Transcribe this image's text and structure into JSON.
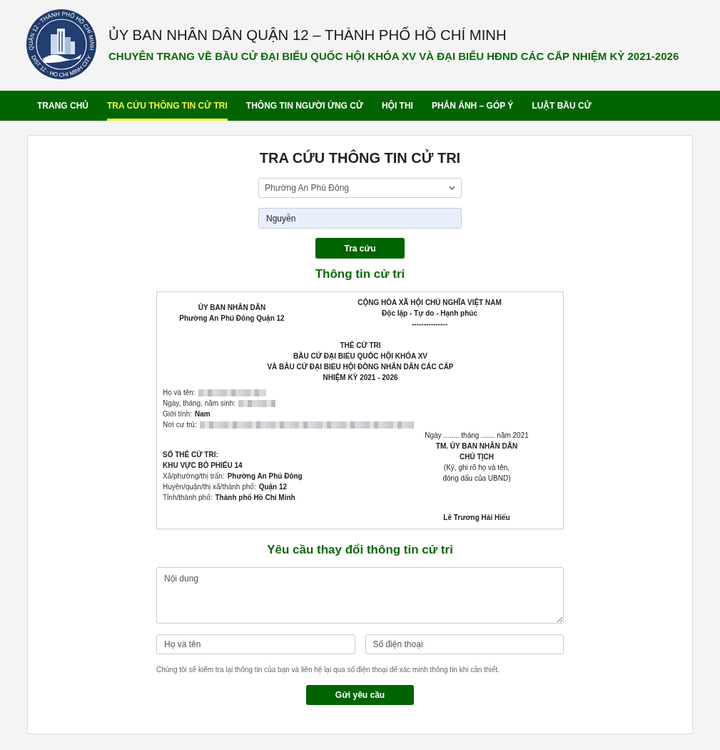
{
  "header": {
    "emblem": {
      "ring_top": "QUẬN 12 - THÀNH PHỐ HỒ CHÍ MINH",
      "ring_bottom": "DIST 12 - HO CHI MINH CITY"
    },
    "title": "ỦY BAN NHÂN DÂN QUẬN 12 – THÀNH PHỐ HỒ CHÍ MINH",
    "subtitle": "CHUYÊN TRANG VỀ BẦU CỬ ĐẠI BIỂU QUỐC HỘI KHÓA XV VÀ ĐẠI BIỂU HĐND CÁC CẤP NHIỆM KỲ 2021-2026"
  },
  "nav": [
    {
      "label": "TRANG CHỦ",
      "selected": false
    },
    {
      "label": "TRA CỨU THÔNG TIN CỬ TRI",
      "selected": true
    },
    {
      "label": "THÔNG TIN NGƯỜI ỨNG CỬ",
      "selected": false
    },
    {
      "label": "HỘI THI",
      "selected": false
    },
    {
      "label": "PHẢN ÁNH – GÓP Ý",
      "selected": false
    },
    {
      "label": "LUẬT BẦU CỬ",
      "selected": false
    }
  ],
  "lookup": {
    "title": "TRA CỨU THÔNG TIN CỬ TRI",
    "ward_select": {
      "value": "Phường An Phú Đông"
    },
    "name_field": {
      "value": "Nguyễn",
      "autofilled": true
    },
    "button": "Tra cứu"
  },
  "voter_info": {
    "title": "Thông tin cử tri",
    "card": {
      "issuer": [
        "ỦY BAN NHÂN DÂN",
        "Phường An Phú Đông Quận 12"
      ],
      "national_heading": [
        "CỘNG HÒA XÃ HỘI CHỦ NGHĨA VIỆT NAM",
        "Độc lập - Tự do - Hạnh phúc",
        "---------------"
      ],
      "title_lines": [
        "THẺ CỬ TRI",
        "BẦU CỬ ĐẠI BIỂU QUỐC HỘI KHÓA XV",
        "VÀ BẦU CỬ ĐẠI BIỂU HỘI ĐỒNG NHÂN DÂN CÁC CẤP",
        "NHIỆM KỲ 2021 - 2026"
      ],
      "personal_fields": [
        {
          "label": "Họ và tên:",
          "kind": "redacted"
        },
        {
          "label": "Ngày, tháng, năm sinh:",
          "kind": "redacted"
        },
        {
          "label": "Giới tính:",
          "kind": "text",
          "value": "Nam"
        },
        {
          "label": "Nơi cư trú:",
          "kind": "redacted"
        }
      ],
      "card_number_label": "SỐ THẺ CỬ TRI:",
      "polling_area": "KHU VỰC BỎ PHIẾU 14",
      "address_fields": [
        {
          "label": "Xã/phường/thị trấn:",
          "value": "Phường An Phú Đông"
        },
        {
          "label": "Huyện/quận/thị xã/thành phố:",
          "value": "Quận 12"
        },
        {
          "label": "Tỉnh/thành phố:",
          "value": "Thành phố Hồ Chí Minh"
        }
      ],
      "date_line": "Ngày ........ tháng ....... năm 2021",
      "signature": {
        "lines": [
          "TM. ỦY BAN NHÂN DÂN",
          "CHỦ TỊCH"
        ],
        "instructions": [
          "(Ký, ghi rõ họ và tên,",
          "đóng dấu của UBND)"
        ],
        "signer": "Lê Trương Hải Hiếu"
      }
    }
  },
  "change_request": {
    "title": "Yêu cầu thay đổi thông tin cử tri",
    "content_field": {
      "placeholder": "Nội dung"
    },
    "name_field": {
      "placeholder": "Họ và tên"
    },
    "phone_field": {
      "placeholder": "Số điện thoại"
    },
    "note": "Chúng tôi sẽ kiểm tra lại thông tin của bạn và liên hệ lại qua số điện thoại để xác minh thông tin khi cần thiết.",
    "button": "Gửi yêu cầu"
  }
}
